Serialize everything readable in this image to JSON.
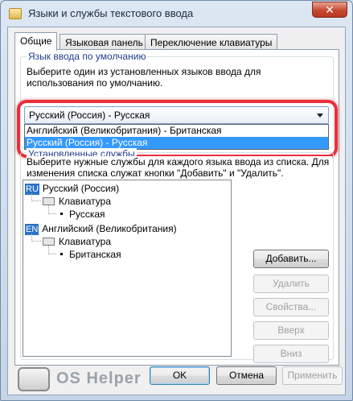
{
  "window": {
    "title": "Языки и службы текстового ввода",
    "close_label": "✕"
  },
  "tabs": [
    {
      "label": "Общие"
    },
    {
      "label": "Языковая панель"
    },
    {
      "label": "Переключение клавиатуры"
    }
  ],
  "default_language": {
    "group_label": "Язык ввода по умолчанию",
    "description": "Выберите один из установленных языков ввода для использования по умолчанию.",
    "selected_value": "Русский (Россия) - Русская",
    "options": [
      "Английский (Великобритания) - Британская",
      "Русский (Россия) - Русская"
    ]
  },
  "services": {
    "group_label": "Установленные службы",
    "description": "Выберите нужные службы для каждого языка ввода из списка. Для изменения списка служат кнопки \"Добавить\" и \"Удалить\".",
    "languages": [
      {
        "badge": "RU",
        "name": "Русский (Россия)",
        "category": "Клавиатура",
        "layout": "Русская"
      },
      {
        "badge": "EN",
        "name": "Английский (Великобритания)",
        "category": "Клавиатура",
        "layout": "Британская"
      }
    ],
    "buttons": {
      "add": "Добавить...",
      "remove": "Удалить",
      "properties": "Свойства...",
      "up": "Вверх",
      "down": "Вниз"
    }
  },
  "footer": {
    "ok": "OK",
    "cancel": "Отмена",
    "apply": "Применить",
    "watermark": "OS Helper"
  },
  "colors": {
    "highlight": "#e9303a",
    "selection": "#3399ff",
    "lang_badge": "#2c72c7"
  }
}
